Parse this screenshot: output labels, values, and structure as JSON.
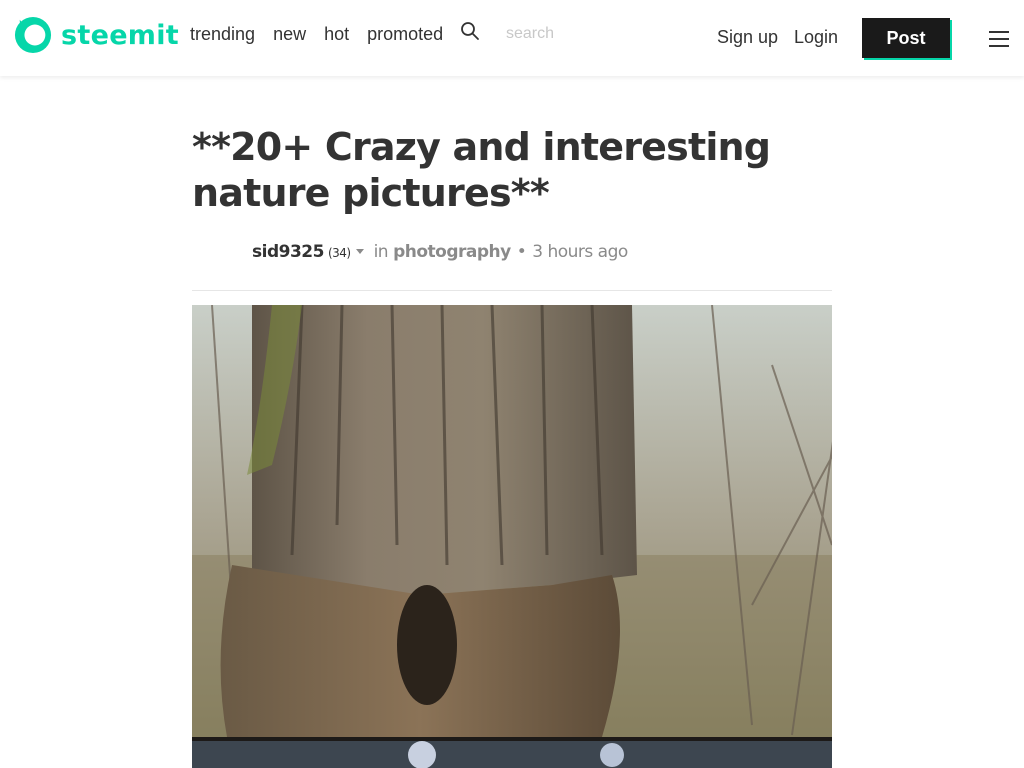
{
  "header": {
    "brand": "steemit",
    "nav": [
      "trending",
      "new",
      "hot",
      "promoted"
    ],
    "search_placeholder": "search",
    "signup": "Sign up",
    "login": "Login",
    "post": "Post",
    "brand_color": "#06d6a9"
  },
  "article": {
    "title": "**20+ Crazy and interesting nature pictures**",
    "author": "sid9325",
    "reputation": "(34)",
    "in_label": "in",
    "category": "photography",
    "dot": "•",
    "time": "3 hours ago"
  },
  "icons": {
    "logo": "steemit-logo-icon",
    "search": "search-icon",
    "menu": "hamburger-menu-icon",
    "caret": "caret-down-icon"
  }
}
